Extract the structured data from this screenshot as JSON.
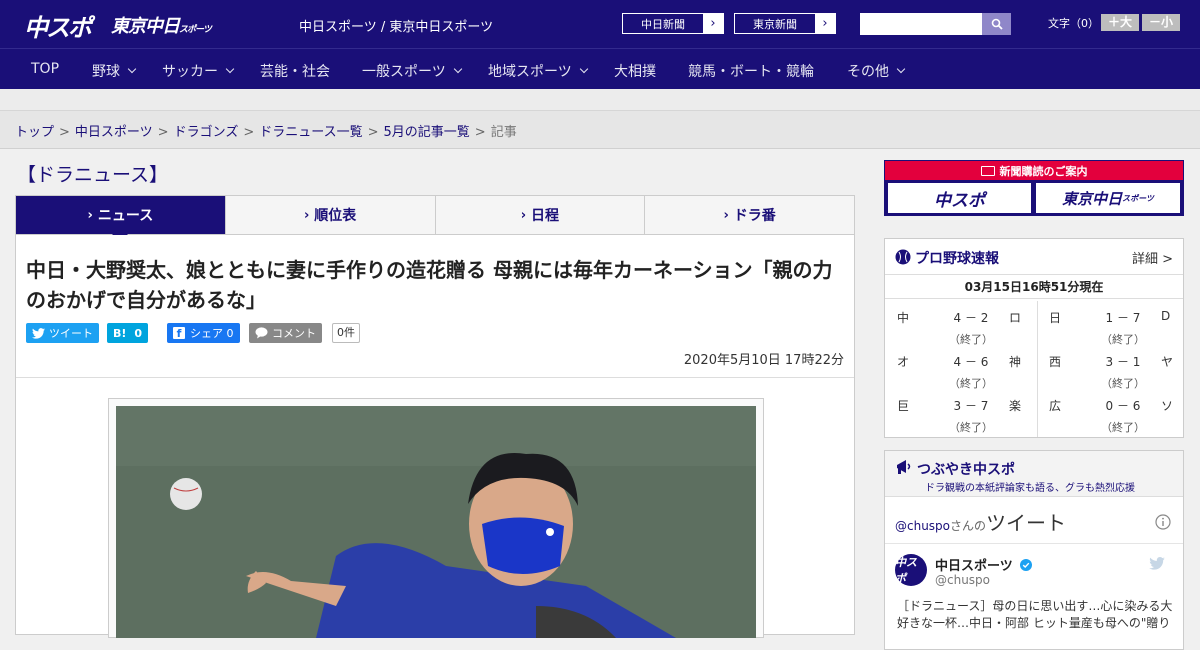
{
  "header": {
    "logo_chuspo": "中スポ",
    "logo_tokyo": "東京中日",
    "logo_tokyo_sub": "スポーツ",
    "site_title": "中日スポーツ / 東京中日スポーツ",
    "btn_chunichi": "中日新聞",
    "btn_tokyo": "東京新聞",
    "font_size_label": "文字（0）",
    "font_larger": "＋大",
    "font_smaller": "－小"
  },
  "nav": {
    "items": [
      "TOP",
      "野球",
      "サッカー",
      "芸能・社会",
      "一般スポーツ",
      "地域スポーツ",
      "大相撲",
      "競馬・ボート・競輪",
      "その他"
    ]
  },
  "breadcrumb": {
    "items": [
      "トップ",
      "中日スポーツ",
      "ドラゴンズ",
      "ドラニュース一覧",
      "5月の記事一覧"
    ],
    "current": "記事",
    "sep": ">"
  },
  "section_title": "【ドラニュース】",
  "tabs": [
    "ニュース",
    "順位表",
    "日程",
    "ドラ番"
  ],
  "article": {
    "headline": "中日・大野奨太、娘とともに妻に手作りの造花贈る 母親には毎年カーネーション「親の力のおかげで自分があるな」",
    "share_tweet": "ツイート",
    "share_hatena_count": "0",
    "share_facebook": "シェア 0",
    "share_comment": "コメント",
    "comment_count": "0件",
    "date": "2020年5月10日 17時22分"
  },
  "ad": {
    "title": "新聞購読のご案内",
    "logo_chuspo": "中スポ",
    "logo_tokyo": "東京中日",
    "logo_tokyo_sub": "スポーツ"
  },
  "scores": {
    "title": "プロ野球速報",
    "more": "詳細 >",
    "time": "03月15日16時51分現在",
    "games": [
      {
        "home": "中",
        "score": "4 － 2",
        "away": "ロ",
        "status": "（終了）"
      },
      {
        "home": "日",
        "score": "1 － 7",
        "away": "D",
        "status": "（終了）"
      },
      {
        "home": "オ",
        "score": "4 － 6",
        "away": "神",
        "status": "（終了）"
      },
      {
        "home": "西",
        "score": "3 － 1",
        "away": "ヤ",
        "status": "（終了）"
      },
      {
        "home": "巨",
        "score": "3 － 7",
        "away": "楽",
        "status": "（終了）"
      },
      {
        "home": "広",
        "score": "0 － 6",
        "away": "ソ",
        "status": "（終了）"
      }
    ]
  },
  "twitter": {
    "title": "つぶやき中スポ",
    "subtitle": "ドラ観戦の本紙評論家も語る、グラも熱烈応援",
    "handle_link": "@chuspo",
    "san_no": "さんの",
    "tweet_word": "ツイート",
    "account_name": "中日スポーツ",
    "account_handle": "@chuspo",
    "avatar_text": "中スポ",
    "tweet_text": "［ドラニュース］母の日に思い出す…心に染みる大好きな一杯…中日・阿部 ヒット量産も母への\"贈り"
  }
}
